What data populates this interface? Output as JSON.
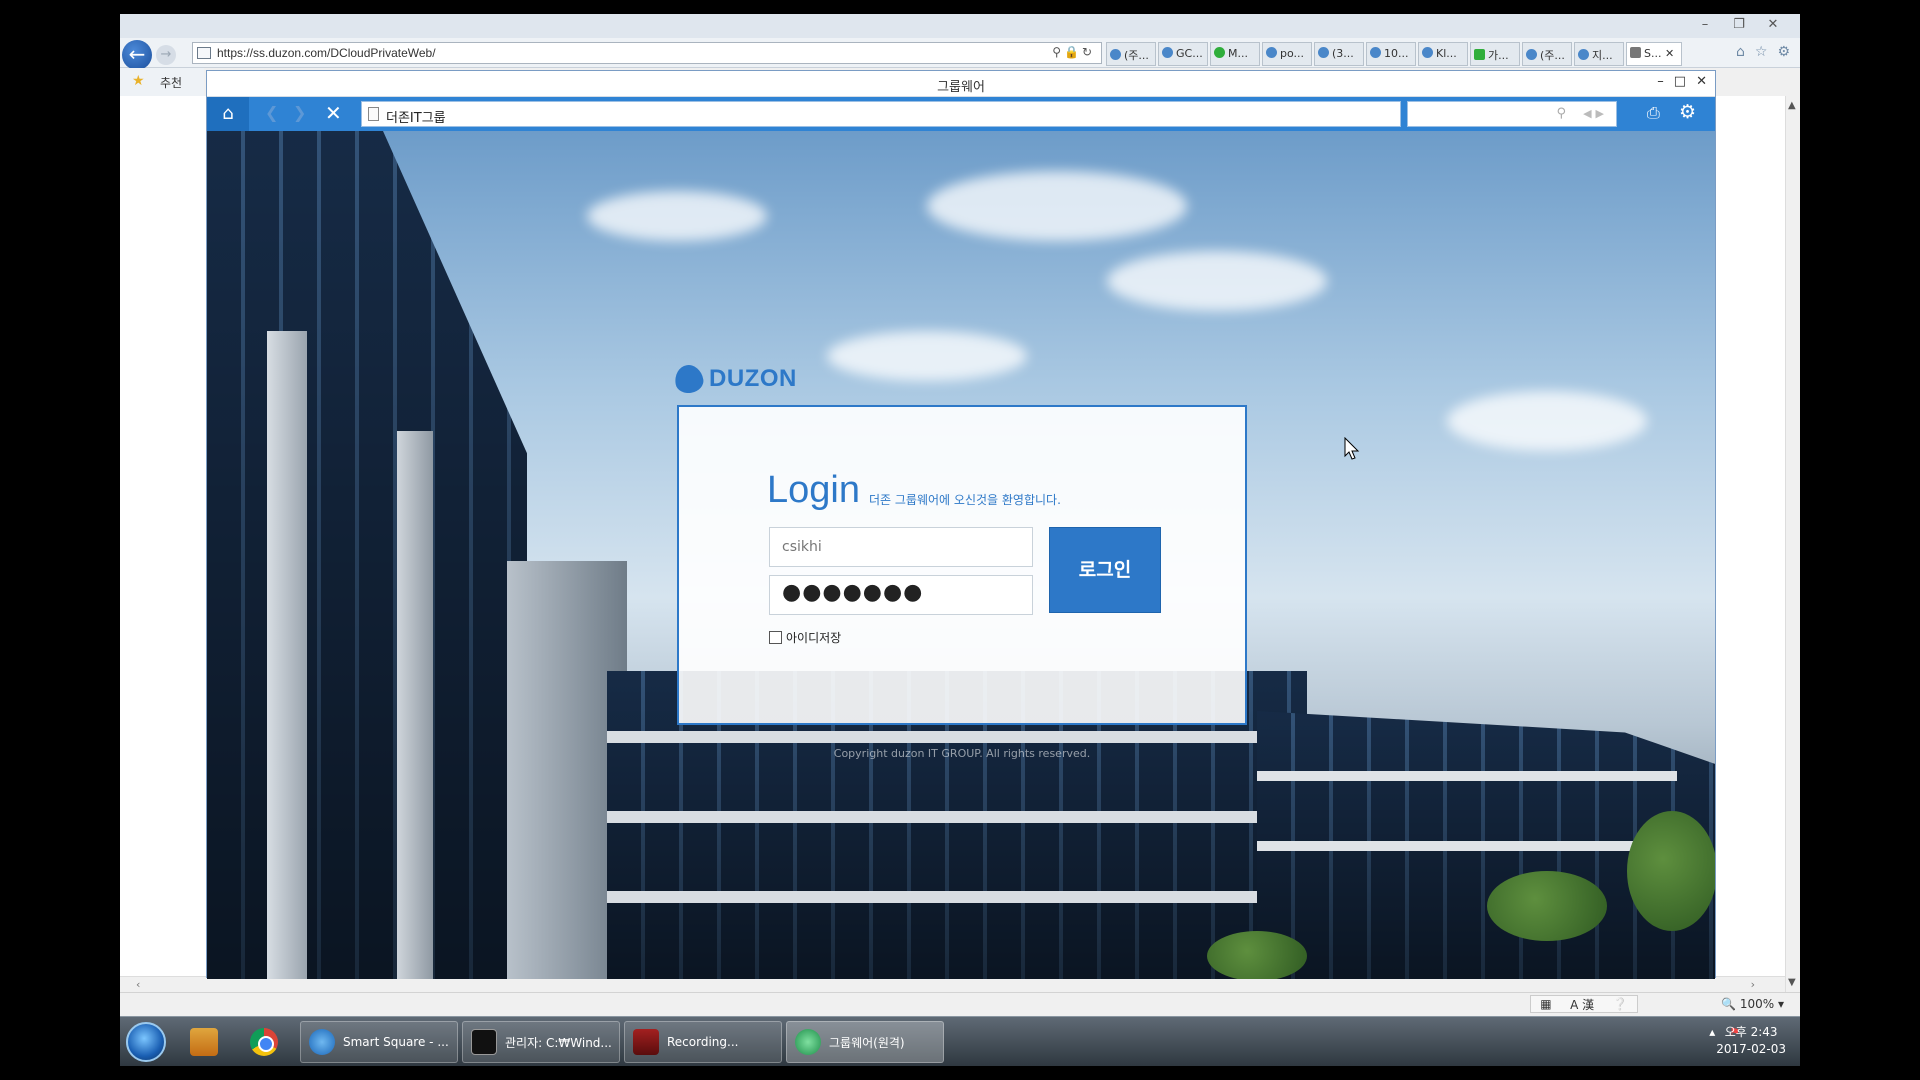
{
  "browser": {
    "url": "https://ss.duzon.com/DCloudPrivateWeb/",
    "favorites_label": "추천",
    "tabs": [
      {
        "label": "(주..."
      },
      {
        "label": "GC..."
      },
      {
        "label": "M..."
      },
      {
        "label": "po..."
      },
      {
        "label": "(3..."
      },
      {
        "label": "10..."
      },
      {
        "label": "Kl..."
      },
      {
        "label": "가..."
      },
      {
        "label": "(주..."
      },
      {
        "label": "지..."
      },
      {
        "label": "S..."
      }
    ],
    "zoom": "100%"
  },
  "groupware": {
    "window_title": "그룹웨어",
    "address_text": "더존IT그룹"
  },
  "login": {
    "logo_text": "DUZON",
    "title": "Login",
    "welcome": "더존 그룹웨어에 오신것을 환영합니다.",
    "user_id": "csikhi",
    "password_mask": "●●●●●●●",
    "button_label": "로그인",
    "remember_label": "아이디저장",
    "copyright": "Copyright duzon IT GROUP. All rights reserved."
  },
  "taskbar": {
    "items": [
      {
        "label": "Smart Square - ..."
      },
      {
        "label": "관리자: C:₩Wind..."
      },
      {
        "label": "Recording..."
      },
      {
        "label": "그룹웨어(원격)"
      }
    ],
    "ime": "A 漢",
    "time": "오후 2:43",
    "date": "2017-02-03"
  }
}
